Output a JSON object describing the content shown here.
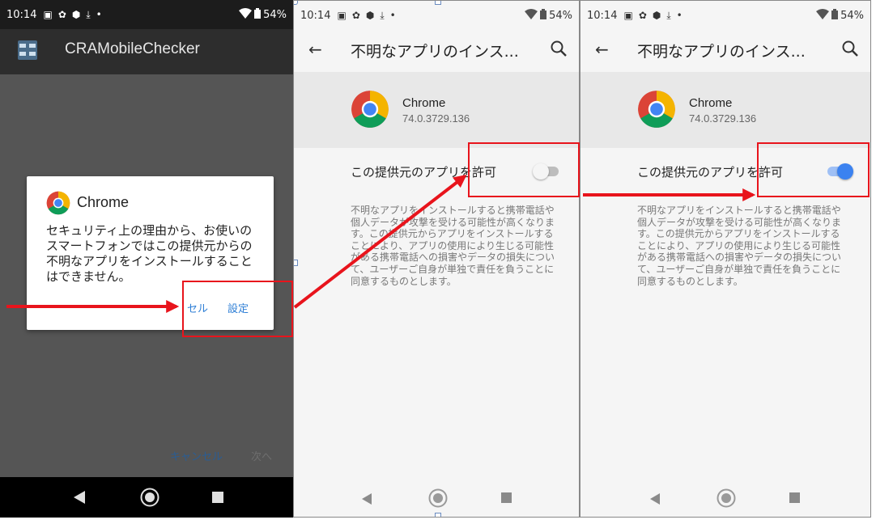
{
  "screen1": {
    "status": {
      "time": "10:14",
      "battery": "54%"
    },
    "app_title": "CRAMobileChecker",
    "dialog": {
      "title": "Chrome",
      "body": "セキュリティ上の理由から、お使いのスマートフォンではこの提供元からの不明なアプリをインストールすることはできません。",
      "cancel_label": "セル",
      "settings_label": "設定"
    },
    "cancel_label": "キャンセル",
    "next_label": "次へ"
  },
  "screen2": {
    "status": {
      "time": "10:14",
      "battery": "54%"
    },
    "title": "不明なアプリのインス...",
    "app_name": "Chrome",
    "app_version": "74.0.3729.136",
    "permission_label": "この提供元のアプリを許可",
    "toggle_on": false,
    "description": "不明なアプリをインストールすると携帯電話や個人データが攻撃を受ける可能性が高くなります。この提供元からアプリをインストールすることにより、アプリの使用により生じる可能性がある携帯電話への損害やデータの損失について、ユーザーご自身が単独で責任を負うことに同意するものとします。"
  },
  "screen3": {
    "status": {
      "time": "10:14",
      "battery": "54%"
    },
    "title": "不明なアプリのインス...",
    "app_name": "Chrome",
    "app_version": "74.0.3729.136",
    "permission_label": "この提供元のアプリを許可",
    "toggle_on": true,
    "description": "不明なアプリをインストールすると携帯電話や個人データが攻撃を受ける可能性が高くなります。この提供元からアプリをインストールすることにより、アプリの使用により生じる可能性がある携帯電話への損害やデータの損失について、ユーザーご自身が単独で責任を負うことに同意するものとします。"
  },
  "colors": {
    "annotation": "#e8141c",
    "accent": "#2f7fd6",
    "toggle_on": "#3b82f0"
  },
  "icons": [
    "back-arrow-icon",
    "search-icon",
    "chrome-icon",
    "wifi-icon",
    "battery-icon",
    "nav-back-icon",
    "nav-home-icon",
    "nav-recents-icon"
  ]
}
